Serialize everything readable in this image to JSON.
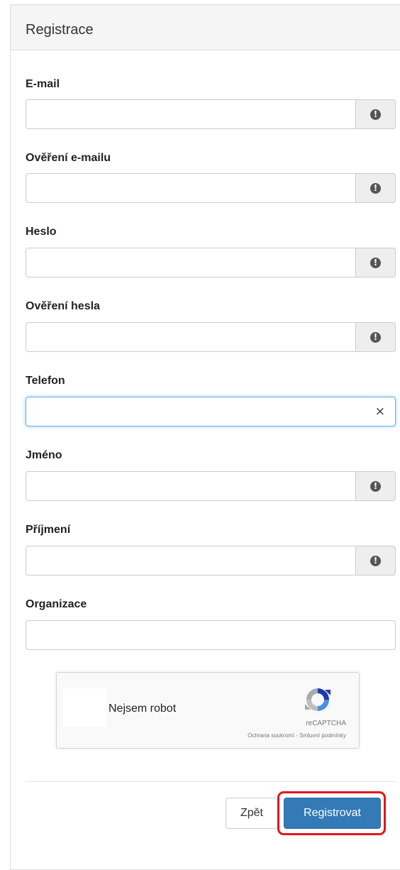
{
  "panel": {
    "title": "Registrace"
  },
  "fields": {
    "email": {
      "label": "E-mail",
      "value": ""
    },
    "email_confirm": {
      "label": "Ověření e-mailu",
      "value": ""
    },
    "password": {
      "label": "Heslo",
      "value": ""
    },
    "password_confirm": {
      "label": "Ověření hesla",
      "value": ""
    },
    "phone": {
      "label": "Telefon",
      "value": ""
    },
    "first_name": {
      "label": "Jméno",
      "value": ""
    },
    "last_name": {
      "label": "Příjmení",
      "value": ""
    },
    "organization": {
      "label": "Organizace",
      "value": ""
    }
  },
  "icons": {
    "required": "exclamation-circle-icon",
    "clear": "close-icon",
    "recaptcha": "recaptcha-logo-icon"
  },
  "glyphs": {
    "required": "!",
    "clear": "×"
  },
  "recaptcha": {
    "label": "Nejsem robot",
    "brand": "reCAPTCHA",
    "links": "Ochrana soukromí - Smluvní podmínky"
  },
  "buttons": {
    "back": "Zpět",
    "register": "Registrovat"
  },
  "colors": {
    "primary": "#337ab7",
    "highlight": "#e5141f",
    "focus": "#66afe9"
  }
}
